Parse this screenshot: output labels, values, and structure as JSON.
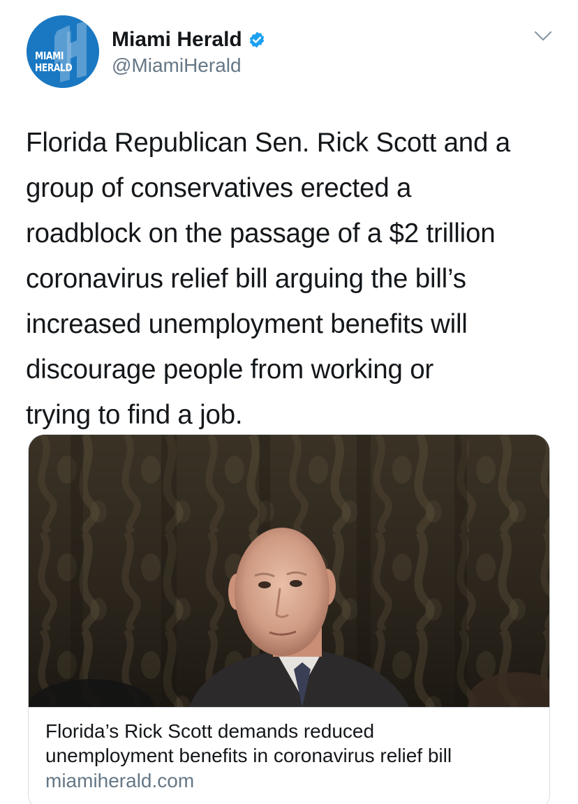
{
  "author": {
    "display_name": "Miami Herald",
    "handle": "@MiamiHerald",
    "verified": true,
    "avatar_text_line1": "MIAMI",
    "avatar_text_line2": "HERALD",
    "avatar_color": "#1a78c2"
  },
  "tweet": {
    "text_lines": [
      "Florida Republican Sen. Rick Scott and a",
      "group of conservatives erected a",
      "roadblock on the passage of a $2 trillion",
      "coronavirus relief bill arguing the bill’s",
      "increased unemployment benefits will",
      "discourage people from working or",
      "trying to find a job."
    ]
  },
  "card": {
    "image_alt": "photo",
    "title_line1": "Florida’s Rick Scott demands reduced",
    "title_line2": "unemployment benefits in coronavirus relief bill",
    "domain": "miamiherald.com"
  },
  "icons": {
    "verified": "verified-badge-icon",
    "menu": "chevron-down-icon"
  },
  "colors": {
    "text": "#14171a",
    "secondary": "#657786",
    "verified": "#1da1f2",
    "border": "#d6dde3"
  }
}
